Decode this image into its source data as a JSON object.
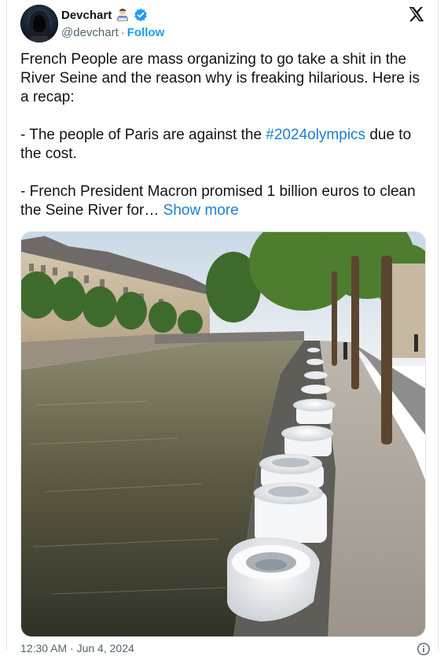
{
  "author": {
    "name": "Devchart",
    "handle": "@devchart",
    "separator": "·",
    "follow_label": "Follow"
  },
  "tweet": {
    "paragraph1": "French People are mass organizing to go take a shit in the River Seine and the reason why is freaking hilarious. Here is a recap:",
    "paragraph2_prefix": "- The people of Paris are against the ",
    "paragraph2_hashtag": "#2024olympics",
    "paragraph2_suffix": " due to the cost.",
    "paragraph3_text": "- French President Macron promised 1 billion euros to clean the Seine River for… ",
    "show_more_label": "Show more"
  },
  "footer": {
    "timestamp_partial": "12:30 AM · Jun 4, 2024"
  },
  "icons": {
    "brand": "x-logo-icon",
    "verified": "verified-badge-icon",
    "info": "info-icon"
  },
  "colors": {
    "link": "#1d9bf0",
    "verified": "#1d9bf0",
    "text": "#0f1419",
    "secondary": "#536471"
  }
}
